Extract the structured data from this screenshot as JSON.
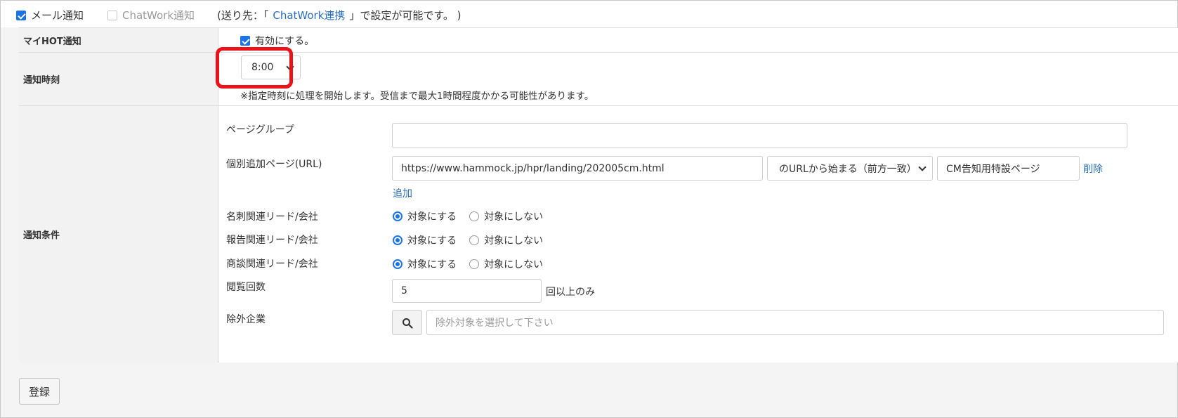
{
  "notify_channels": {
    "mail_label": "メール通知",
    "mail_checked": true,
    "chatwork_label": "ChatWork通知",
    "chatwork_checked": false,
    "note_prefix": "(送り先：「",
    "note_link": "ChatWork連携",
    "note_suffix": "」で設定が可能です。 )"
  },
  "rows": {
    "my_hot": {
      "header": "マイHOT通知",
      "checkbox_label": "有効にする。",
      "checked": true
    },
    "notify_time": {
      "header": "通知時刻",
      "selected": "8:00",
      "note": "※指定時刻に処理を開始します。受信まで最大1時間程度かかる可能性があります。"
    },
    "conditions": {
      "header": "通知条件",
      "page_group_label": "ページグループ",
      "page_group_value": "",
      "individual_label": "個別追加ページ(URL)",
      "url_value": "https://www.hammock.jp/hpr/landing/202005cm.html",
      "match_selected": "のURLから始まる（前方一致）",
      "page_name_value": "CM告知用特設ページ",
      "delete_link": "削除",
      "add_link": "追加",
      "radio_rows": [
        {
          "label": "名刺関連リード/会社",
          "on": "対象にする",
          "off": "対象にしない"
        },
        {
          "label": "報告関連リード/会社",
          "on": "対象にする",
          "off": "対象にしない"
        },
        {
          "label": "商談関連リード/会社",
          "on": "対象にする",
          "off": "対象にしない"
        }
      ],
      "view_count_label": "閲覧回数",
      "view_count_value": "5",
      "view_count_suffix": "回以上のみ",
      "exclude_label": "除外企業",
      "exclude_placeholder": "除外対象を選択して下さい"
    }
  },
  "submit_label": "登録",
  "colors": {
    "accent": "#1a73e8",
    "link": "#2a6ebb",
    "highlight": "#e8141a"
  },
  "icons": {
    "search": "search-icon",
    "select": "chevron-down-icon"
  }
}
